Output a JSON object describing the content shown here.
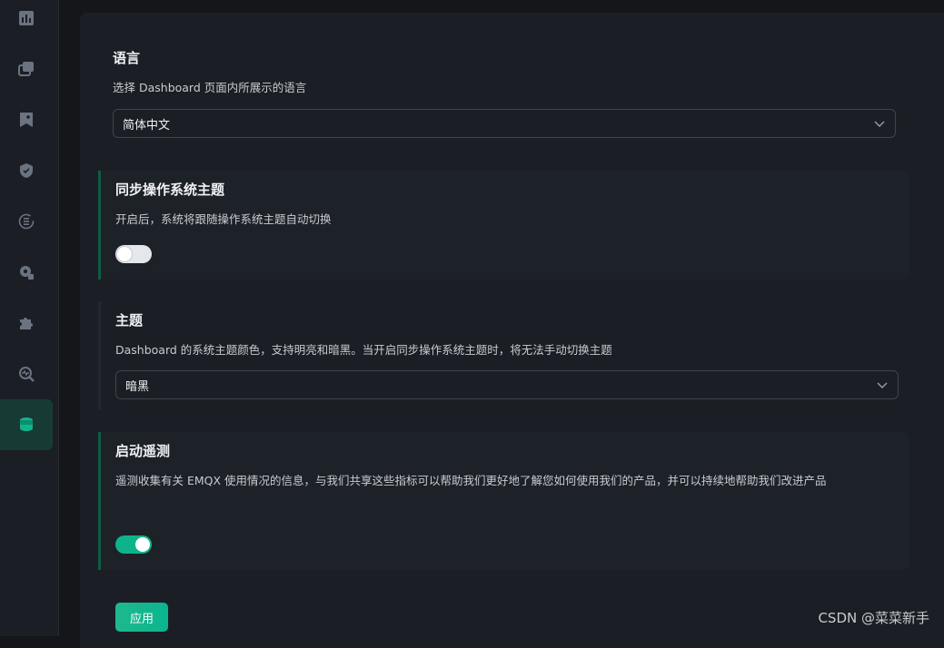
{
  "sidebar": {
    "items": [
      {
        "icon": "chart-icon"
      },
      {
        "icon": "windows-icon"
      },
      {
        "icon": "bookmark-add-icon"
      },
      {
        "icon": "shield-check-icon"
      },
      {
        "icon": "refresh-list-icon"
      },
      {
        "icon": "gear-puzzle-icon"
      },
      {
        "icon": "puzzle-icon"
      },
      {
        "icon": "monitor-search-icon"
      },
      {
        "icon": "database-icon",
        "active": true
      }
    ]
  },
  "settings": {
    "language": {
      "title": "语言",
      "desc": "选择 Dashboard 页面内所展示的语言",
      "value": "简体中文"
    },
    "sync_theme": {
      "title": "同步操作系统主题",
      "desc": "开启后，系统将跟随操作系统主题自动切换",
      "enabled": false
    },
    "theme": {
      "title": "主题",
      "desc": "Dashboard 的系统主题颜色，支持明亮和暗黑。当开启同步操作系统主题时，将无法手动切换主题",
      "value": "暗黑"
    },
    "telemetry": {
      "title": "启动遥测",
      "desc": "遥测收集有关 EMQX 使用情况的信息，与我们共享这些指标可以帮助我们更好地了解您如何使用我们的产品，并可以持续地帮助我们改进产品",
      "enabled": true
    }
  },
  "apply_label": "应用",
  "watermark": "CSDN @菜菜新手",
  "colors": {
    "accent": "#0fb38b",
    "background": "#1b1f25",
    "toggle_off": "#e4e7ec"
  }
}
